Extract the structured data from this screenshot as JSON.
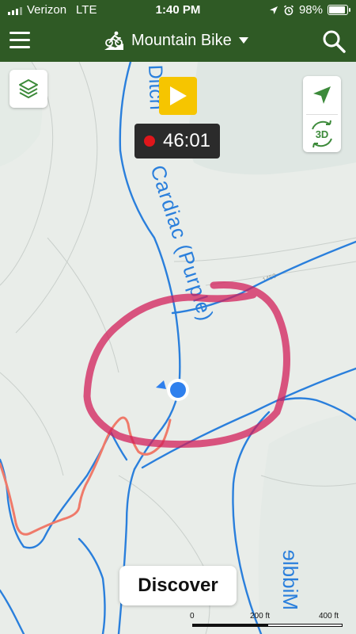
{
  "status_bar": {
    "carrier": "Verizon",
    "network": "LTE",
    "time": "1:40 PM",
    "battery": "98%",
    "battery_level": 0.98,
    "icons": [
      "location-arrow-icon",
      "alarm-icon"
    ]
  },
  "header": {
    "activity": "Mountain Bike",
    "menu_icon": "hamburger-menu-icon",
    "activity_icon": "mountain-bike-icon",
    "dropdown_icon": "caret-down-icon",
    "search_icon": "search-icon"
  },
  "map": {
    "trail_label_main": "Cardiac (Purple)",
    "trail_label_top": "Ditch",
    "trail_label_bottom": "Middle",
    "contour_label": "1450",
    "colors": {
      "trail": "#2a7fdc",
      "recorded_track": "#ef7a6a",
      "annotation_circle": "#d21f5a",
      "location_dot": "#2f80ed"
    }
  },
  "controls": {
    "layers_icon": "layers-icon",
    "play_icon": "play-icon",
    "timer": "46:01",
    "recording_icon": "recording-dot-icon",
    "locate_icon": "navigation-arrow-icon",
    "view_3d_label": "3D"
  },
  "discover": {
    "label": "Discover"
  },
  "scale": {
    "labels": [
      "0",
      "200 ft",
      "400 ft"
    ]
  }
}
